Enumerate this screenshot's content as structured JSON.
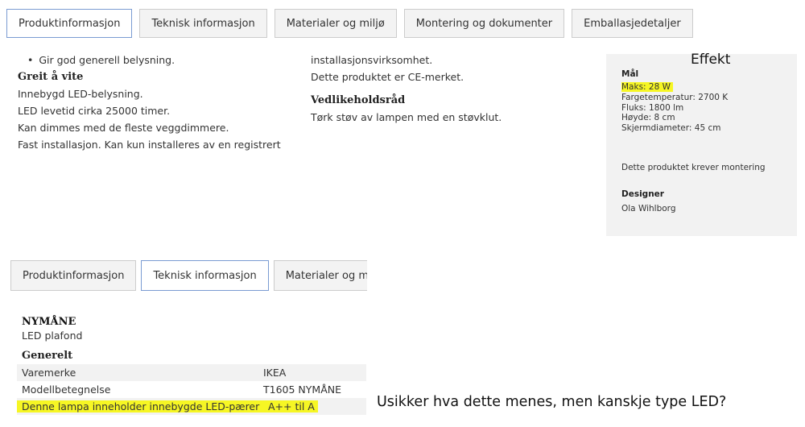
{
  "top_tabs": [
    {
      "label": "Produktinformasjon",
      "active": true
    },
    {
      "label": "Teknisk informasjon",
      "active": false
    },
    {
      "label": "Materialer og miljø",
      "active": false
    },
    {
      "label": "Montering og dokumenter",
      "active": false
    },
    {
      "label": "Emballasjedetaljer",
      "active": false
    }
  ],
  "info_left": {
    "bullet": "Gir god generell belysning.",
    "heading": "Greit å vite",
    "lines": [
      "Innebygd LED-belysning.",
      "LED levetid cirka 25000 timer.",
      "Kan dimmes med de fleste veggdimmere.",
      "Fast installasjon. Kan kun installeres av en registrert"
    ]
  },
  "info_mid": {
    "line1": "installasjonsvirksomhet.",
    "line2": "Dette produktet er CE-merket.",
    "heading": "Vedlikeholdsråd",
    "line3": "Tørk støv av lampen med en støvklut."
  },
  "spec_panel": {
    "annotation": "Effekt",
    "title": "Mål",
    "max_power": "Maks: 28 W",
    "specs": [
      "Fargetemperatur: 2700 K",
      "Fluks: 1800 lm",
      "Høyde: 8 cm",
      "Skjermdiameter: 45 cm"
    ],
    "assembly_note": "Dette produktet krever montering",
    "designer_title": "Designer",
    "designer_name": "Ola Wihlborg"
  },
  "bottom_tabs": [
    {
      "label": "Produktinformasjon",
      "active": false
    },
    {
      "label": "Teknisk informasjon",
      "active": true
    },
    {
      "label": "Materialer og miljø",
      "active": false
    }
  ],
  "product": {
    "name": "NYMÅNE",
    "type": "LED plafond",
    "group": "Generelt"
  },
  "tech_table": [
    {
      "key": "Varemerke",
      "value": "IKEA",
      "shaded": true,
      "highlight": false
    },
    {
      "key": "Modellbetegnelse",
      "value": "T1605 NYMÅNE",
      "shaded": false,
      "highlight": false
    },
    {
      "key": "Denne lampa inneholder innebygde LED-pærer",
      "value": "A++ til A",
      "shaded": true,
      "highlight": true
    }
  ],
  "question": "Usikker hva dette menes, men kanskje type LED?",
  "colors": {
    "highlight": "#f6f624",
    "active_tab_border": "#7a9bd2",
    "panel_bg": "#f2f2f2"
  }
}
